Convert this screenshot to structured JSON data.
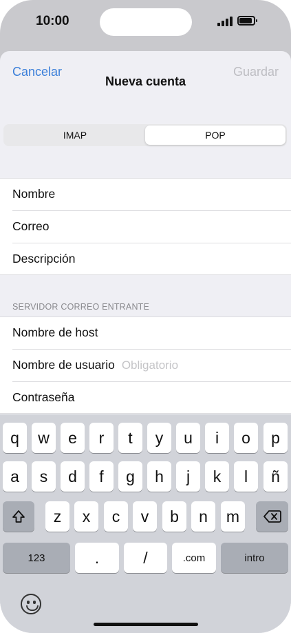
{
  "status_bar": {
    "time": "10:00"
  },
  "nav": {
    "cancel": "Cancelar",
    "title": "Nueva cuenta",
    "save": "Guardar"
  },
  "segmented": {
    "options": [
      "IMAP",
      "POP"
    ],
    "selected": "POP"
  },
  "account_fields": [
    {
      "label": "Nombre"
    },
    {
      "label": "Correo"
    },
    {
      "label": "Descripción"
    }
  ],
  "incoming_server": {
    "header": "SERVIDOR CORREO ENTRANTE",
    "fields": [
      {
        "label": "Nombre de host",
        "placeholder": ""
      },
      {
        "label": "Nombre de usuario",
        "placeholder": "Obligatorio"
      },
      {
        "label": "Contraseña",
        "placeholder": ""
      }
    ]
  },
  "keyboard": {
    "row1": [
      "q",
      "w",
      "e",
      "r",
      "t",
      "y",
      "u",
      "i",
      "o",
      "p"
    ],
    "row2": [
      "a",
      "s",
      "d",
      "f",
      "g",
      "h",
      "j",
      "k",
      "l",
      "ñ"
    ],
    "row3": [
      "z",
      "x",
      "c",
      "v",
      "b",
      "n",
      "m"
    ],
    "bottom": {
      "numbers": "123",
      "dot": ".",
      "slash": "/",
      "dotcom": ".com",
      "return": "intro"
    },
    "shift_icon": "shift-icon",
    "delete_icon": "delete-icon",
    "emoji_icon": "emoji-icon"
  }
}
